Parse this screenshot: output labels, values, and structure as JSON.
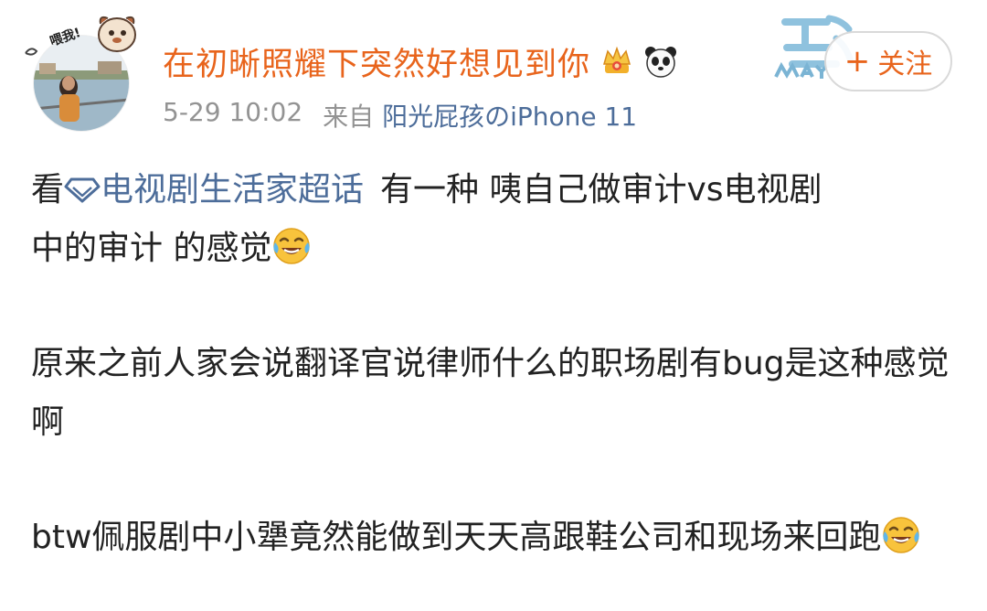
{
  "header": {
    "username": "在初晰照耀下突然好想见到你",
    "pendant_text": "喂我!",
    "time": "5-29 10:02",
    "from_label": "来自",
    "source": "阳光屁孩のiPhone 11",
    "follow_label": "关注",
    "follow_icon": "plus-icon",
    "badges": [
      "crown-badge-icon",
      "panda-badge-icon"
    ]
  },
  "post": {
    "p1": {
      "prefix": "看",
      "topic": "电视剧生活家超话",
      "rest_line1": "有一种 咦自己做审计vs电视剧",
      "rest_line2": "中的审计 的感觉"
    },
    "p2": {
      "text": "原来之前人家会说翻译官说律师什么的职场剧有bug是这种感觉啊"
    },
    "p3": {
      "text": "btw佩服剧中小犟竟然能做到天天高跟鞋公司和现场来回跑"
    }
  },
  "emoji": "laughing-tears-emoji",
  "colors": {
    "username": "#e8641c",
    "link": "#4d6d9a",
    "meta": "#939393",
    "text": "#222222"
  }
}
